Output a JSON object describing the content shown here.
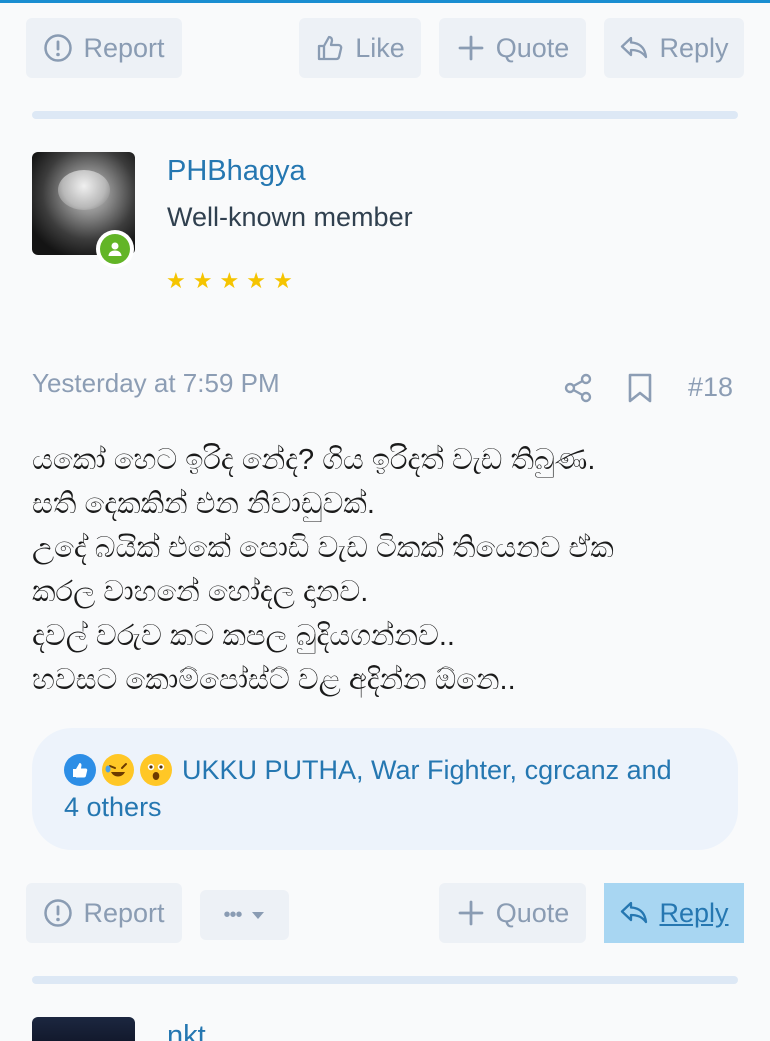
{
  "prev_post_actions": {
    "report_label": "Report",
    "like_label": "Like",
    "quote_label": "Quote",
    "reply_label": "Reply"
  },
  "post": {
    "author": {
      "name": "PHBhagya",
      "title": "Well-known member",
      "rating_stars": 5,
      "online": true
    },
    "timestamp": "Yesterday at 7:59 PM",
    "post_number": "#18",
    "body_lines": [
      "යකෝ හෙට ඉරිද නේද? ගිය ඉරිදත් වැඩ තිබුණ.",
      "සති දෙකකින් එන නිවාඩුවක්.",
      "උදේ බයික් එකේ පොඩි වැඩ ටිකක් තියෙනව ඒක",
      "කරල වාහනේ හෝදල දානව.",
      "දවල් වරුව කට කපල බුදියගන්නව..",
      "හවසට කොම්පෝස්ට් වළ අදින්න ඕනෙ.."
    ],
    "reactions": {
      "icons": [
        "like",
        "rolling-laughing",
        "astonished"
      ],
      "users_text": "UKKU PUTHA, War Fighter, cgrcanz and",
      "others_text": "4 others"
    },
    "actions": {
      "report_label": "Report",
      "more_label": "•••",
      "quote_label": "Quote",
      "reply_label": "Reply"
    }
  },
  "next_post": {
    "author_name": "nkt"
  },
  "colors": {
    "accent": "#2577b1",
    "muted": "#8c9db4",
    "button_bg": "#edf1f6",
    "reply_active_bg": "#a8d6f2",
    "online": "#63b527",
    "star": "#f5c400"
  }
}
